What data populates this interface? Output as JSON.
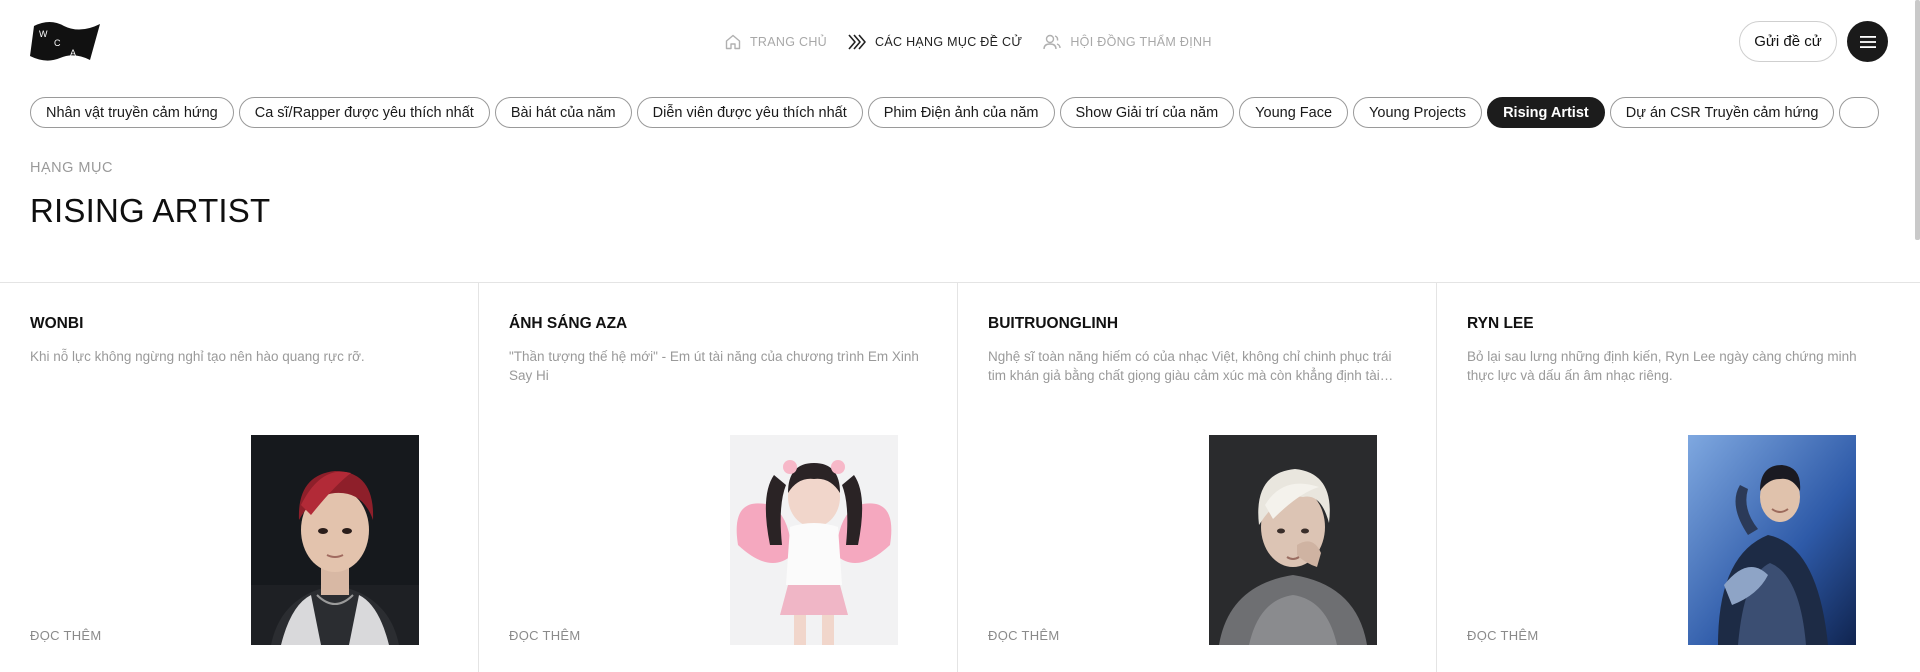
{
  "logo": {
    "letters": [
      "W",
      "C",
      "A"
    ],
    "icon": "wca-flag-logo"
  },
  "nav": [
    {
      "label": "TRANG CHỦ",
      "icon": "home-icon",
      "active": false
    },
    {
      "label": "CÁC HẠNG MỤC ĐỀ CỬ",
      "icon": "chevrons-icon",
      "active": true
    },
    {
      "label": "HỘI ĐỒNG THẨM ĐỊNH",
      "icon": "users-icon",
      "active": false
    }
  ],
  "actions": {
    "nominate_label": "Gửi đề cử",
    "menu_icon": "hamburger-menu-icon"
  },
  "categories": [
    {
      "label": "Nhân vật truyền cảm hứng",
      "active": false
    },
    {
      "label": "Ca sĩ/Rapper được yêu thích nhất",
      "active": false
    },
    {
      "label": "Bài hát của năm",
      "active": false
    },
    {
      "label": "Diễn viên được yêu thích nhất",
      "active": false
    },
    {
      "label": "Phim Điện ảnh của năm",
      "active": false
    },
    {
      "label": "Show Giải trí của năm",
      "active": false
    },
    {
      "label": "Young Face",
      "active": false
    },
    {
      "label": "Young Projects",
      "active": false
    },
    {
      "label": "Rising Artist",
      "active": true
    },
    {
      "label": "Dự án CSR Truyền cảm hứng",
      "active": false
    },
    {
      "label": "",
      "active": false
    }
  ],
  "section": {
    "eyebrow": "HẠNG MỤC",
    "title": "RISING ARTIST"
  },
  "nominees": [
    {
      "name": "WONBI",
      "description": "Khi nỗ lực không ngừng nghỉ tạo nên hào quang rực rỡ.",
      "read_more": "ĐỌC THÊM",
      "photo": "portrait-red-hair"
    },
    {
      "name": "ÁNH SÁNG AZA",
      "description": "\"Thần tượng thế hệ mới\" - Em út tài năng của chương trình Em Xinh Say Hi",
      "read_more": "ĐỌC THÊM",
      "photo": "portrait-pink-wings"
    },
    {
      "name": "BUITRUONGLINH",
      "description": "Nghệ sĩ toàn năng hiếm có của nhạc Việt, không chỉ chinh phục trái tim khán giả bằng chất giọng giàu cảm xúc mà còn khẳng định tài năng",
      "read_more": "ĐỌC THÊM",
      "photo": "portrait-platinum-hair"
    },
    {
      "name": "RYN LEE",
      "description": "Bỏ lại sau lưng những định kiến, Ryn Lee ngày càng chứng minh thực lực và dấu ấn âm nhạc riêng.",
      "read_more": "ĐỌC THÊM",
      "photo": "portrait-blue-jacket"
    }
  ]
}
